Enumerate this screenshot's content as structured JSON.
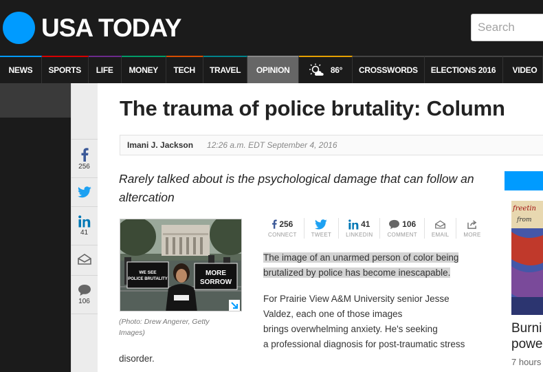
{
  "header": {
    "logo_text": "USA TODAY",
    "search_placeholder": "Search"
  },
  "nav": {
    "items": [
      "NEWS",
      "SPORTS",
      "LIFE",
      "MONEY",
      "TECH",
      "TRAVEL",
      "OPINION",
      "CROSSWORDS",
      "ELECTIONS 2016",
      "VIDEO"
    ],
    "weather_temp": "86°",
    "active": "OPINION"
  },
  "share_rail": {
    "facebook_count": "256",
    "linkedin_count": "41",
    "comment_count": "106"
  },
  "article": {
    "headline": "The trauma of police brutality: Column",
    "author": "Imani J. Jackson",
    "date": "12:26 a.m. EDT September 4, 2016",
    "subhead": "Rarely talked about is the psychological damage that can follow an altercation",
    "photo_caption": "(Photo: Drew Angerer, Getty Images)",
    "sign_left": "WE SEE POLICE BRUTALITY",
    "sign_right": "MORE SORROW",
    "share_bar": [
      {
        "icon": "facebook-icon",
        "count": "256",
        "label": "CONNECT"
      },
      {
        "icon": "twitter-icon",
        "count": "",
        "label": "TWEET"
      },
      {
        "icon": "linkedin-icon",
        "count": "41",
        "label": "LINKEDIN"
      },
      {
        "icon": "comment-icon",
        "count": "106",
        "label": "COMMENT"
      },
      {
        "icon": "email-icon",
        "count": "",
        "label": "EMAIL"
      },
      {
        "icon": "more-icon",
        "count": "",
        "label": "MORE"
      }
    ],
    "highlight_para": "The image of an unarmed person of color being brutalized by police has become inescapable.",
    "body_line1": "For Prairie View A&M University senior Jesse",
    "body_line2": "Valdez, each one of those images",
    "body_line3": "brings overwhelming anxiety. He's seeking",
    "body_line4": "a professional diagnosis for post-traumatic stress",
    "body_tail": "disorder."
  },
  "right_rail": {
    "title_line1": "Burni",
    "title_line2": "powe",
    "time": "7 hours"
  },
  "colors": {
    "brand_blue": "#009bff",
    "header_bg": "#1b1b1b",
    "nav_active": "#666666",
    "facebook": "#3b5998",
    "twitter": "#1da1f2",
    "linkedin": "#0077b5"
  }
}
